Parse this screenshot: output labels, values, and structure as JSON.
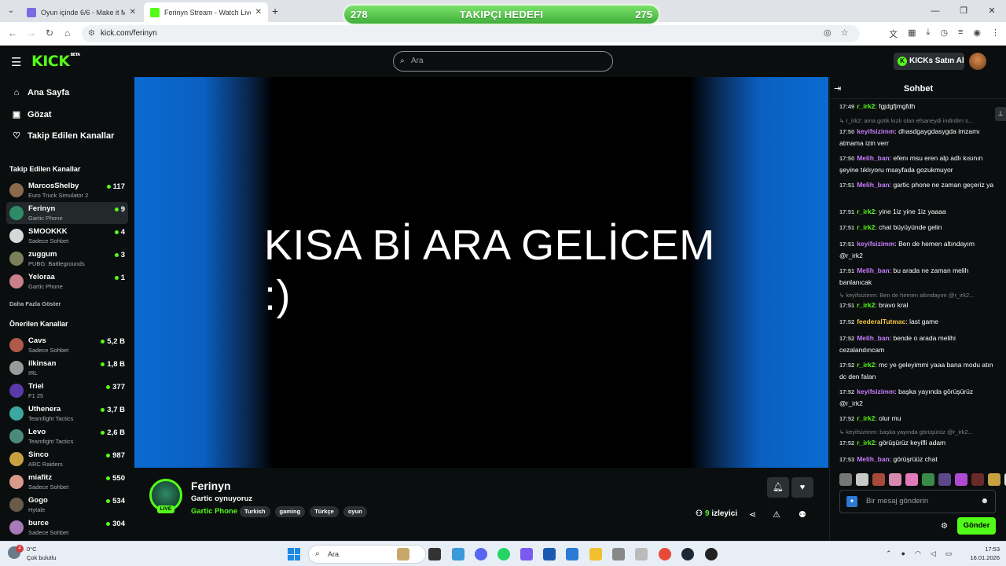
{
  "browser": {
    "tabs": [
      {
        "title": "Oyun içinde 6/6 - Make it Meme",
        "active": false
      },
      {
        "title": "Ferinyn Stream - Watch Live on Kick",
        "active": true
      }
    ],
    "url": "kick.com/ferinyn"
  },
  "goal": {
    "left": "278",
    "title": "TAKIPÇI HEDEFI",
    "right": "275"
  },
  "header": {
    "logo": "KICK",
    "beta": "BETA",
    "search_placeholder": "Ara",
    "kicks_button": "KICKs Satın Al"
  },
  "sidebar": {
    "nav": [
      {
        "label": "Ana Sayfa",
        "icon": "home-icon"
      },
      {
        "label": "Gözat",
        "icon": "browse-icon"
      },
      {
        "label": "Takip Edilen Kanallar",
        "icon": "heart-icon"
      }
    ],
    "followed_heading": "Takip Edilen Kanallar",
    "followed": [
      {
        "name": "MarcosShelby",
        "category": "Euro Truck Simulator 2",
        "viewers": "117"
      },
      {
        "name": "Ferinyn",
        "category": "Gartic Phone",
        "viewers": "9"
      },
      {
        "name": "SMOOKKK",
        "category": "Sadece Sohbet",
        "viewers": "4"
      },
      {
        "name": "zuggum",
        "category": "PUBG: Battlegrounds",
        "viewers": "3"
      },
      {
        "name": "Yeloraa",
        "category": "Gartic Phone",
        "viewers": "1"
      }
    ],
    "show_more": "Daha Fazla Göster",
    "recommended_heading": "Önerilen Kanallar",
    "recommended": [
      {
        "name": "Cavs",
        "category": "Sadece Sohbet",
        "viewers": "5,2 B"
      },
      {
        "name": "ilkinsan",
        "category": "IRL",
        "viewers": "1,8 B"
      },
      {
        "name": "Triel",
        "category": "F1 25",
        "viewers": "377"
      },
      {
        "name": "Uthenera",
        "category": "Teamfight Tactics",
        "viewers": "3,7 B"
      },
      {
        "name": "Levo",
        "category": "Teamfight Tactics",
        "viewers": "2,6 B"
      },
      {
        "name": "Sinco",
        "category": "ARC Raiders",
        "viewers": "987"
      },
      {
        "name": "miafitz",
        "category": "Sadece Sohbet",
        "viewers": "550"
      },
      {
        "name": "Gogo",
        "category": "Hytale",
        "viewers": "534"
      },
      {
        "name": "burce",
        "category": "Sadece Sohbet",
        "viewers": "304"
      }
    ]
  },
  "video": {
    "line1": "KISA Bİ ARA GELİCEM",
    "line2": ":)"
  },
  "stream": {
    "name": "Ferinyn",
    "title": "Gartic oynuyoruz",
    "category": "Gartic Phone",
    "live_badge": "LIVE",
    "tags": [
      "Turkish",
      "gaming",
      "Türkçe",
      "oyun"
    ],
    "viewer_count": "9",
    "viewer_label": "izleyici"
  },
  "chat": {
    "title": "Sohbet",
    "messages": [
      {
        "time": "17:49",
        "user": "r_irk2",
        "color": "#53fc18",
        "text": "fgjdgfjmgfdh"
      },
      {
        "reply": "r_irk2: ama gotik kızlı olan efsaneydi indirdim s..."
      },
      {
        "time": "17:50",
        "user": "keyifsizimm",
        "color": "#c77dff",
        "text": "dhasdgaygdasygda imzamı atmama izin verr"
      },
      {
        "time": "17:50",
        "user": "Melih_ban",
        "color": "#c77dff",
        "text": "efenı msu eren alp adlı kısının şeyine tıklıyoru msayfada gozukmuyor"
      },
      {
        "time": "17:51",
        "user": "Melih_ban",
        "color": "#c77dff",
        "text": "gartic phone ne zaman geçeriz ya"
      },
      {
        "time": "17:51",
        "user": "r_irk2",
        "color": "#53fc18",
        "text": "yine 1iz yine 1iz yaaaa"
      },
      {
        "time": "17:51",
        "user": "r_irk2",
        "color": "#53fc18",
        "text": "chat büyüyünde gelin"
      },
      {
        "time": "17:51",
        "user": "keyifsizimm",
        "color": "#c77dff",
        "text": "Ben de hemen altındayım @r_irk2"
      },
      {
        "time": "17:51",
        "user": "Melih_ban",
        "color": "#c77dff",
        "text": "bu arada ne zaman melih banlanıcak"
      },
      {
        "reply": "keyifsizimm: Ben de hemen altındayım @r_irk2..."
      },
      {
        "time": "17:51",
        "user": "r_irk2",
        "color": "#53fc18",
        "text": "bravo kral"
      },
      {
        "time": "17:52",
        "user": "feederalTutmac",
        "color": "#f5c542",
        "text": "last game"
      },
      {
        "time": "17:52",
        "user": "Melih_ban",
        "color": "#c77dff",
        "text": "bende o arada melihi cezalandıncam"
      },
      {
        "time": "17:52",
        "user": "r_irk2",
        "color": "#53fc18",
        "text": "mc ye geleyimmi yaaa bana modu atın dc den falan"
      },
      {
        "time": "17:52",
        "user": "keyifsizimm",
        "color": "#c77dff",
        "text": "başka yayında görüşürüz @r_irk2"
      },
      {
        "time": "17:52",
        "user": "r_irk2",
        "color": "#53fc18",
        "text": "olur mu"
      },
      {
        "reply": "keyifsizimm: başka yayında görüşürüz @r_irk2..."
      },
      {
        "time": "17:52",
        "user": "r_irk2",
        "color": "#53fc18",
        "text": "görüşürüz keyifli adam"
      },
      {
        "time": "17:53",
        "user": "Melih_ban",
        "color": "#c77dff",
        "text": "görüşrüüz chat"
      }
    ],
    "input_placeholder": "Bir mesaj gönderin",
    "send_label": "Gönder"
  },
  "taskbar": {
    "weather_badge": "4",
    "temperature": "0°C",
    "condition": "Çok bulutlu",
    "search_placeholder": "Ara",
    "time": "17:53",
    "date": "16.01.2026"
  }
}
